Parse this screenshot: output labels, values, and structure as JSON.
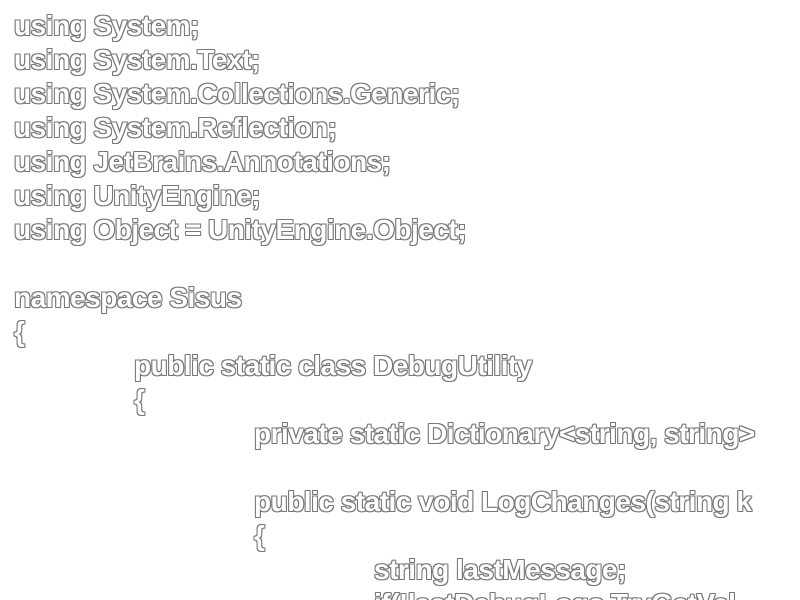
{
  "code": {
    "lines": [
      "using System;",
      "using System.Text;",
      "using System.Collections.Generic;",
      "using System.Reflection;",
      "using JetBrains.Annotations;",
      "using UnityEngine;",
      "using Object = UnityEngine.Object;",
      "",
      "namespace Sisus",
      "{",
      "public static class DebugUtility",
      "{",
      "private static Dictionary<string, string>",
      "",
      "public static void LogChanges(string k",
      "{",
      "string lastMessage;",
      "if(!lastDebugLogs.TryGetVal"
    ]
  },
  "colors": {
    "background": "#ffffff",
    "text_fill": "#ffffff",
    "text_outline": "#777777"
  }
}
